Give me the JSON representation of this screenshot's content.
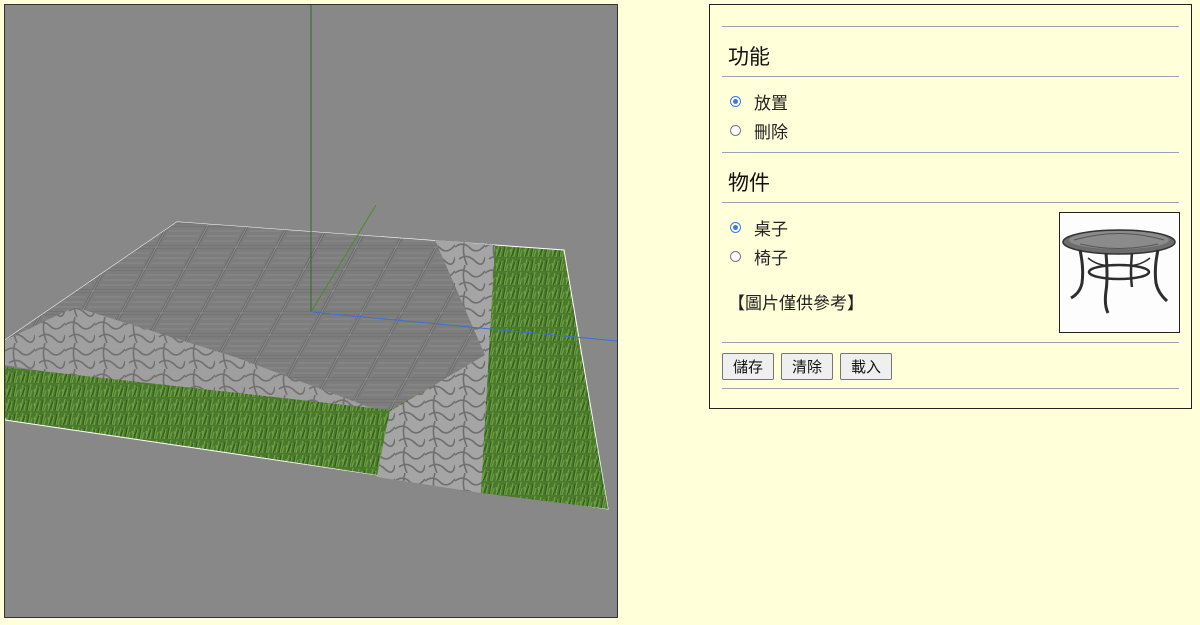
{
  "panel": {
    "function_section": {
      "title": "功能",
      "options": [
        {
          "label": "放置",
          "checked": true
        },
        {
          "label": "刪除",
          "checked": false
        }
      ]
    },
    "object_section": {
      "title": "物件",
      "options": [
        {
          "label": "桌子",
          "checked": true
        },
        {
          "label": "椅子",
          "checked": false
        }
      ],
      "reference_note": "【圖片僅供參考】",
      "preview_alt": "table preview"
    },
    "buttons": {
      "save": "儲存",
      "clear": "清除",
      "load": "載入"
    }
  },
  "colors": {
    "page_background": "#ffffd9",
    "viewport_background": "#888888",
    "radio_accent": "#3b78e7",
    "grass": "#4e7d2f",
    "stone": "#9a9a9a"
  }
}
